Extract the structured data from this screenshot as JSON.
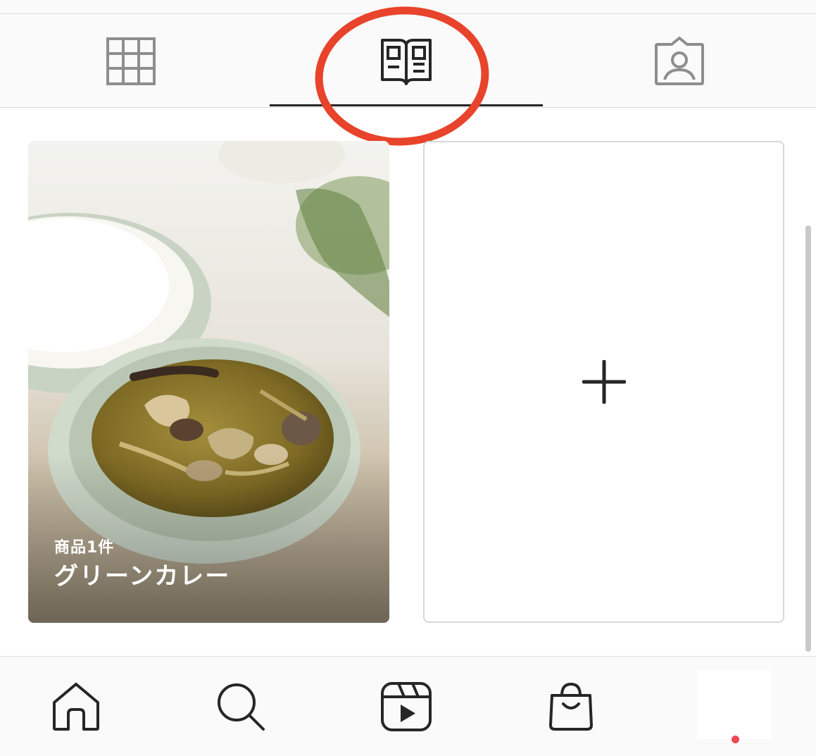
{
  "tabs": [
    {
      "id": "grid",
      "icon": "grid-icon",
      "selected": false
    },
    {
      "id": "guides",
      "icon": "guide-book-icon",
      "selected": true
    },
    {
      "id": "tagged",
      "icon": "tagged-person-icon",
      "selected": false
    }
  ],
  "annotation": {
    "shape": "ellipse",
    "color": "#e8432b",
    "target": "tab-guides"
  },
  "cards": [
    {
      "type": "guide",
      "count_label": "商品1件",
      "title": "グリーンカレー",
      "image": "green-curry-photo"
    },
    {
      "type": "add",
      "icon": "plus-icon"
    }
  ],
  "bottom_nav": [
    {
      "id": "home",
      "icon": "home-icon"
    },
    {
      "id": "search",
      "icon": "search-icon"
    },
    {
      "id": "reels",
      "icon": "reels-icon"
    },
    {
      "id": "shop",
      "icon": "shop-bag-icon"
    },
    {
      "id": "profile",
      "icon": "profile-avatar",
      "has_notification": true
    }
  ],
  "colors": {
    "accent_annotation": "#e8432b",
    "notification": "#ed4956",
    "icon": "#262626",
    "tab_inactive": "#8e8e8e"
  }
}
